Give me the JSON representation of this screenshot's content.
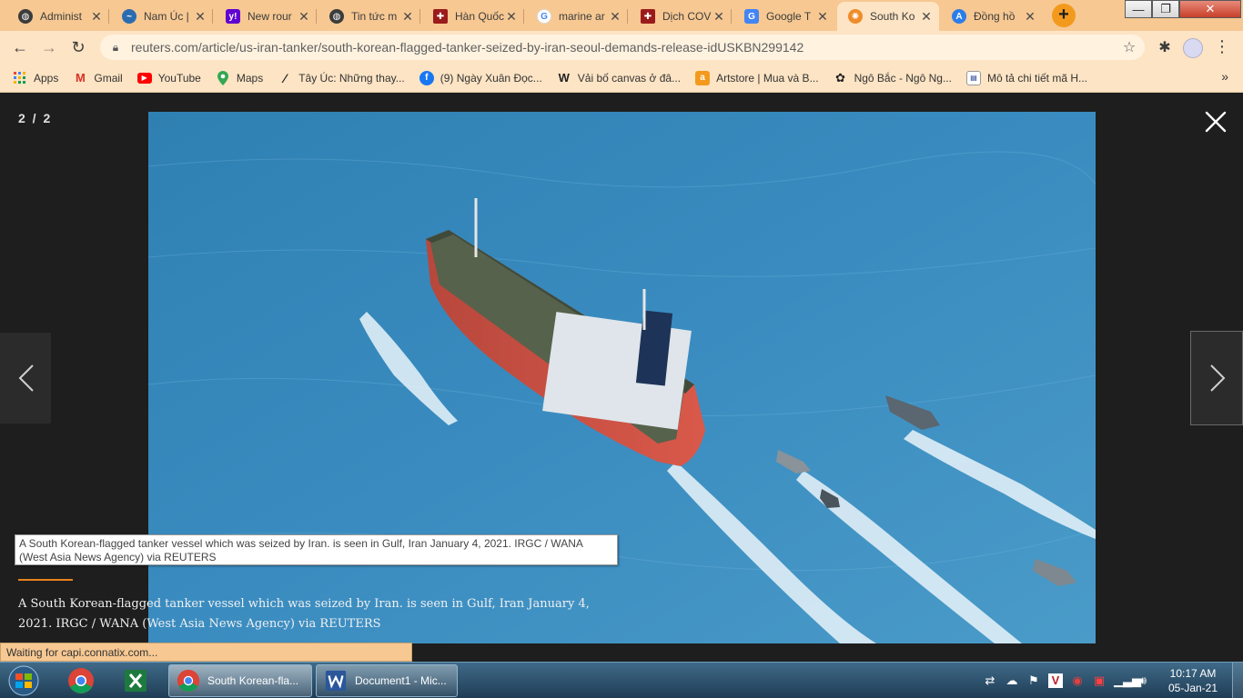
{
  "tabs": [
    {
      "title": "Administ",
      "icon": "globe-icon",
      "color": "#3c3c3c"
    },
    {
      "title": "Nam Úc |",
      "icon": "bird-icon",
      "color": "#2b6cb0"
    },
    {
      "title": "New rour",
      "icon": "yahoo-icon",
      "color": "#6001d2"
    },
    {
      "title": "Tin tức m",
      "icon": "globe-icon",
      "color": "#3c3c3c"
    },
    {
      "title": "Hàn Quốc",
      "icon": "red-cross-icon",
      "color": "#9b1b1b"
    },
    {
      "title": "marine ar",
      "icon": "google-icon",
      "color": "#4285f4"
    },
    {
      "title": "Dịch COV",
      "icon": "red-cross-icon",
      "color": "#9b1b1b"
    },
    {
      "title": "Google T",
      "icon": "google-translate-icon",
      "color": "#4285f4"
    },
    {
      "title": "South Ko",
      "icon": "reuters-icon",
      "color": "#f08c28"
    },
    {
      "title": "Đồng hồ",
      "icon": "chevron-a-icon",
      "color": "#2b7de9"
    }
  ],
  "window": {
    "minimize": "—",
    "maximize": "❐",
    "close": "✕"
  },
  "url": "reuters.com/article/us-iran-tanker/south-korean-flagged-tanker-seized-by-iran-seoul-demands-release-idUSKBN299142",
  "bookmarks": [
    {
      "label": "Apps",
      "icon": "apps-grid-icon"
    },
    {
      "label": "Gmail",
      "icon": "gmail-icon"
    },
    {
      "label": "YouTube",
      "icon": "youtube-icon"
    },
    {
      "label": "Maps",
      "icon": "maps-pin-icon"
    },
    {
      "label": "Tây Úc: Những thay...",
      "icon": "feather-icon"
    },
    {
      "label": "(9) Ngày Xuân Đọc...",
      "icon": "facebook-icon"
    },
    {
      "label": "Vải bố canvas ở đâ...",
      "icon": "w-logo-icon"
    },
    {
      "label": "Artstore | Mua và B...",
      "icon": "artstore-icon"
    },
    {
      "label": "Ngô Bắc - Ngô Ng...",
      "icon": "figure-icon"
    },
    {
      "label": "Mô tả chi tiết mã H...",
      "icon": "doc-icon"
    }
  ],
  "bookmarks_more": "»",
  "viewer": {
    "counter": "2 / 2",
    "tooltip": "A South Korean-flagged tanker vessel which was seized by Iran. is seen in Gulf, Iran January 4, 2021. IRGC / WANA (West Asia News Agency) via REUTERS",
    "caption": "A South Korean-flagged tanker vessel which was seized by Iran. is seen in Gulf, Iran January 4, 2021. IRGC / WANA (West Asia News Agency) via REUTERS",
    "accent": "#e8821e"
  },
  "status": "Waiting for capi.connatix.com...",
  "taskbar": {
    "tasks": [
      {
        "label": "South Korean-fla...",
        "icon": "chrome-icon"
      },
      {
        "label": "Document1 - Mic...",
        "icon": "word-icon"
      }
    ],
    "time": "10:17 AM",
    "date": "05-Jan-21"
  }
}
